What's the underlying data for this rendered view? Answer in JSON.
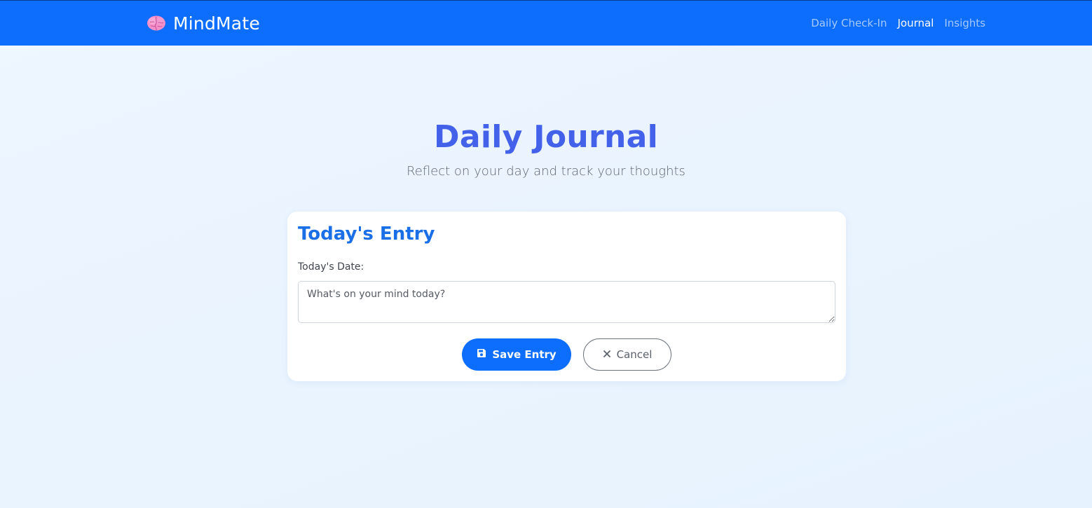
{
  "app": {
    "brand_name": "MindMate",
    "brand_icon": "brain-icon"
  },
  "nav": {
    "items": [
      {
        "label": "Daily Check-In",
        "active": false
      },
      {
        "label": "Journal",
        "active": true
      },
      {
        "label": "Insights",
        "active": false
      }
    ]
  },
  "hero": {
    "title": "Daily Journal",
    "subtitle": "Reflect on your day and track your thoughts"
  },
  "entry_card": {
    "title": "Today's Entry",
    "date_label": "Today's Date:",
    "date_value": "",
    "input_placeholder": "What's on your mind today?",
    "input_value": "",
    "save_label": "Save Entry",
    "save_icon": "floppy-disk-icon",
    "cancel_label": "Cancel",
    "cancel_icon": "close-icon"
  },
  "colors": {
    "navbar": "#0d6efd",
    "title": "#4461ea",
    "card_title": "#1b6fe6",
    "primary_button": "#0d6efd",
    "background": "#eaf4ff"
  }
}
